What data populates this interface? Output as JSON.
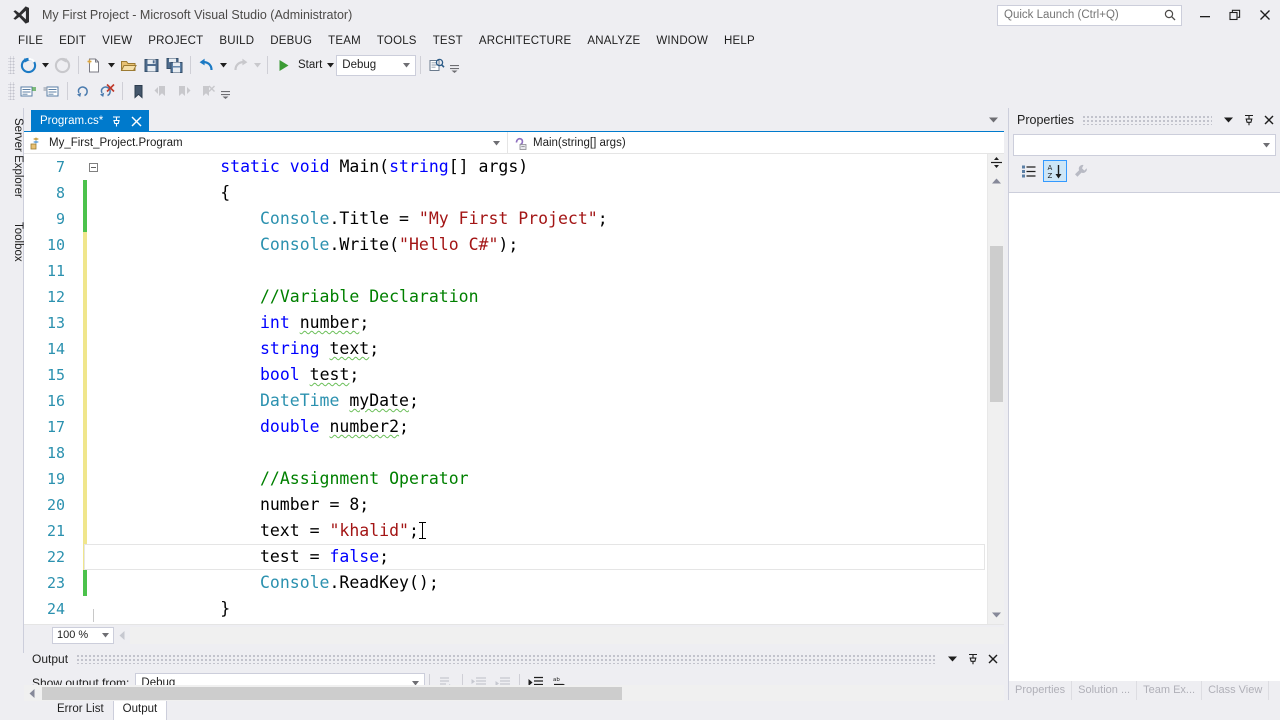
{
  "window": {
    "title": "My First Project - Microsoft Visual Studio (Administrator)",
    "logo_icon": "visual-studio-logo-icon",
    "minimize_label": "Minimize",
    "restore_label": "Restore",
    "close_label": "Close"
  },
  "quick_launch": {
    "placeholder": "Quick Launch (Ctrl+Q)",
    "value": "",
    "icon": "search-icon"
  },
  "menubar": {
    "items": [
      {
        "label": "FILE"
      },
      {
        "label": "EDIT"
      },
      {
        "label": "VIEW"
      },
      {
        "label": "PROJECT"
      },
      {
        "label": "BUILD"
      },
      {
        "label": "DEBUG"
      },
      {
        "label": "TEAM"
      },
      {
        "label": "TOOLS"
      },
      {
        "label": "TEST"
      },
      {
        "label": "ARCHITECTURE"
      },
      {
        "label": "ANALYZE"
      },
      {
        "label": "WINDOW"
      },
      {
        "label": "HELP"
      }
    ]
  },
  "toolbar": {
    "navigate_back_icon": "navigate-back-icon",
    "navigate_forward_icon": "navigate-forward-icon",
    "new_item_icon": "new-item-icon",
    "open_file_icon": "open-file-icon",
    "save_icon": "save-icon",
    "save_all_icon": "save-all-icon",
    "undo_icon": "undo-icon",
    "redo_icon": "redo-icon",
    "start_icon": "start-play-icon",
    "start_label": "Start",
    "config_value": "Debug",
    "find_in_files_icon": "find-in-files-icon",
    "overflow_icon": "toolbar-overflow-icon",
    "comment_icon": "comment-selection-icon",
    "uncomment_icon": "uncomment-selection-icon",
    "undo_nav_icon": "undo-last-navigation-icon",
    "cancel_nav_icon": "cancel-navigation-icon",
    "bookmark_icon": "toggle-bookmark-icon",
    "prev_bookmark_icon": "previous-bookmark-icon",
    "next_bookmark_icon": "next-bookmark-icon",
    "clear_bookmarks_icon": "clear-bookmarks-icon"
  },
  "left_dock": {
    "tabs": [
      {
        "label": "Server Explorer"
      },
      {
        "label": "Toolbox"
      }
    ]
  },
  "document": {
    "tab": {
      "label": "Program.cs*",
      "pin_icon": "pin-icon",
      "close_icon": "close-icon"
    },
    "tab_list_icon": "tab-list-dropdown-icon",
    "navbar": {
      "type_icon": "class-member-icon",
      "type_value": "My_First_Project.Program",
      "member_icon": "method-member-icon",
      "member_value": "Main(string[] args)",
      "caret_icon": "chevron-down-icon"
    },
    "zoom_level": "100 %",
    "zoom_caret_icon": "chevron-down-icon"
  },
  "code": {
    "lines": [
      {
        "number": "7",
        "change": "none",
        "outline": "collapse",
        "current": false,
        "tokens": [
          {
            "t": "            ",
            "c": "p"
          },
          {
            "t": "static",
            "c": "k"
          },
          {
            "t": " ",
            "c": "p"
          },
          {
            "t": "void",
            "c": "k"
          },
          {
            "t": " Main(",
            "c": "p"
          },
          {
            "t": "string",
            "c": "k"
          },
          {
            "t": "[] args)",
            "c": "p"
          }
        ]
      },
      {
        "number": "8",
        "change": "green",
        "outline": "line",
        "current": false,
        "tokens": [
          {
            "t": "            {",
            "c": "p"
          }
        ]
      },
      {
        "number": "9",
        "change": "green",
        "outline": "line",
        "current": false,
        "tokens": [
          {
            "t": "                ",
            "c": "p"
          },
          {
            "t": "Console",
            "c": "t"
          },
          {
            "t": ".Title = ",
            "c": "p"
          },
          {
            "t": "\"My First Project\"",
            "c": "s"
          },
          {
            "t": ";",
            "c": "p"
          }
        ]
      },
      {
        "number": "10",
        "change": "yellow",
        "outline": "line",
        "current": false,
        "tokens": [
          {
            "t": "                ",
            "c": "p"
          },
          {
            "t": "Console",
            "c": "t"
          },
          {
            "t": ".Write(",
            "c": "p"
          },
          {
            "t": "\"Hello C#\"",
            "c": "s"
          },
          {
            "t": ");",
            "c": "p"
          }
        ]
      },
      {
        "number": "11",
        "change": "yellow",
        "outline": "line",
        "current": false,
        "tokens": []
      },
      {
        "number": "12",
        "change": "yellow",
        "outline": "line",
        "current": false,
        "tokens": [
          {
            "t": "                ",
            "c": "p"
          },
          {
            "t": "//Variable Declaration",
            "c": "c"
          }
        ]
      },
      {
        "number": "13",
        "change": "yellow",
        "outline": "line",
        "current": false,
        "tokens": [
          {
            "t": "                ",
            "c": "p"
          },
          {
            "t": "int",
            "c": "k"
          },
          {
            "t": " ",
            "c": "p"
          },
          {
            "t": "number",
            "c": "p",
            "squiggle": true
          },
          {
            "t": ";",
            "c": "p"
          }
        ]
      },
      {
        "number": "14",
        "change": "yellow",
        "outline": "line",
        "current": false,
        "tokens": [
          {
            "t": "                ",
            "c": "p"
          },
          {
            "t": "string",
            "c": "k"
          },
          {
            "t": " ",
            "c": "p"
          },
          {
            "t": "text",
            "c": "p",
            "squiggle": true
          },
          {
            "t": ";",
            "c": "p"
          }
        ]
      },
      {
        "number": "15",
        "change": "yellow",
        "outline": "line",
        "current": false,
        "tokens": [
          {
            "t": "                ",
            "c": "p"
          },
          {
            "t": "bool",
            "c": "k"
          },
          {
            "t": " ",
            "c": "p"
          },
          {
            "t": "test",
            "c": "p",
            "squiggle": true
          },
          {
            "t": ";",
            "c": "p"
          }
        ]
      },
      {
        "number": "16",
        "change": "yellow",
        "outline": "line",
        "current": false,
        "tokens": [
          {
            "t": "                ",
            "c": "p"
          },
          {
            "t": "DateTime",
            "c": "t"
          },
          {
            "t": " ",
            "c": "p"
          },
          {
            "t": "myDate",
            "c": "p",
            "squiggle": true
          },
          {
            "t": ";",
            "c": "p"
          }
        ]
      },
      {
        "number": "17",
        "change": "yellow",
        "outline": "line",
        "current": false,
        "tokens": [
          {
            "t": "                ",
            "c": "p"
          },
          {
            "t": "double",
            "c": "k"
          },
          {
            "t": " ",
            "c": "p"
          },
          {
            "t": "number2",
            "c": "p",
            "squiggle": true
          },
          {
            "t": ";",
            "c": "p"
          }
        ]
      },
      {
        "number": "18",
        "change": "yellow",
        "outline": "line",
        "current": false,
        "tokens": []
      },
      {
        "number": "19",
        "change": "yellow",
        "outline": "line",
        "current": false,
        "tokens": [
          {
            "t": "                ",
            "c": "p"
          },
          {
            "t": "//Assignment Operator",
            "c": "c"
          }
        ]
      },
      {
        "number": "20",
        "change": "yellow",
        "outline": "line",
        "current": false,
        "tokens": [
          {
            "t": "                number = 8;",
            "c": "p"
          }
        ]
      },
      {
        "number": "21",
        "change": "yellow",
        "outline": "line",
        "current": false,
        "cursor": true,
        "tokens": [
          {
            "t": "                text = ",
            "c": "p"
          },
          {
            "t": "\"khalid\"",
            "c": "s"
          },
          {
            "t": ";",
            "c": "p"
          }
        ]
      },
      {
        "number": "22",
        "change": "yellow",
        "outline": "line",
        "current": true,
        "tokens": [
          {
            "t": "                test = ",
            "c": "p"
          },
          {
            "t": "false",
            "c": "k"
          },
          {
            "t": ";",
            "c": "p"
          }
        ]
      },
      {
        "number": "23",
        "change": "green",
        "outline": "line",
        "current": false,
        "tokens": [
          {
            "t": "                ",
            "c": "p"
          },
          {
            "t": "Console",
            "c": "t"
          },
          {
            "t": ".ReadKey();",
            "c": "p"
          }
        ]
      },
      {
        "number": "24",
        "change": "none",
        "outline": "end",
        "current": false,
        "tokens": [
          {
            "t": "            }",
            "c": "p"
          }
        ]
      }
    ]
  },
  "output_panel": {
    "title": "Output",
    "dropdown_icon": "panel-dropdown-icon",
    "pin_icon": "pin-icon",
    "close_icon": "close-icon",
    "show_output_label": "Show output from:",
    "show_output_value": "Debug",
    "caret_icon": "chevron-down-icon",
    "find_message_icon": "find-message-icon",
    "go_to_previous_icon": "go-to-previous-message-icon",
    "go_to_next_icon": "go-to-next-message-icon",
    "clear_all_icon": "clear-all-icon",
    "toggle_wordwrap_icon": "toggle-word-wrap-icon",
    "tabs": [
      {
        "label": "Error List",
        "active": false
      },
      {
        "label": "Output",
        "active": true
      }
    ]
  },
  "properties_panel": {
    "title": "Properties",
    "dropdown_icon": "panel-dropdown-icon",
    "pin_icon": "pin-icon",
    "close_icon": "close-icon",
    "object_value": "",
    "caret_icon": "chevron-down-icon",
    "categorized_icon": "categorized-view-icon",
    "alphabetical_icon": "alphabetical-sort-icon",
    "properties_icon": "properties-wrench-icon",
    "tabs": [
      {
        "label": "Properties"
      },
      {
        "label": "Solution ..."
      },
      {
        "label": "Team Ex..."
      },
      {
        "label": "Class View"
      }
    ]
  },
  "colors": {
    "accent": "#007ACC",
    "chrome": "#EEEEF2",
    "keyword": "#0000FF",
    "string": "#A31515",
    "comment": "#008000",
    "type": "#2B91AF",
    "line_number": "#2B91AF",
    "change_saved": "#4CC24C",
    "change_unsaved": "#F0E68C"
  }
}
